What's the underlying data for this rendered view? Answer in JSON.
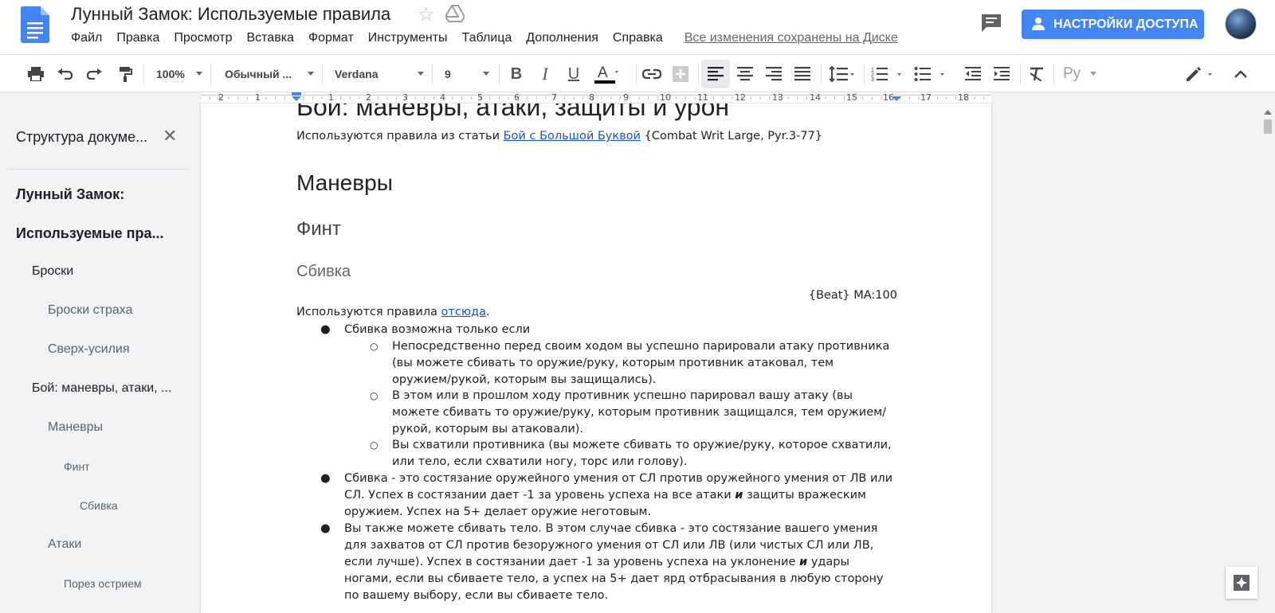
{
  "header": {
    "title": "Лунный Замок: Используемые правила",
    "menu": [
      "Файл",
      "Правка",
      "Просмотр",
      "Вставка",
      "Формат",
      "Инструменты",
      "Таблица",
      "Дополнения",
      "Справка"
    ],
    "save_status": "Все изменения сохранены на Диске",
    "share_label": "НАСТРОЙКИ ДОСТУПА"
  },
  "toolbar": {
    "zoom": "100%",
    "style": "Обычный ...",
    "font": "Verdana",
    "font_size": "9",
    "input_tools": "Ру"
  },
  "ruler": {
    "numbers": [
      "2",
      "1",
      "1",
      "2",
      "3",
      "4",
      "5",
      "6",
      "7",
      "8",
      "9",
      "10",
      "11",
      "12",
      "13",
      "14",
      "15",
      "16",
      "17",
      "18"
    ]
  },
  "outline": {
    "title": "Структура докуме...",
    "items": [
      "Лунный Замок:",
      "Используемые пра...",
      "Броски",
      "Броски страха",
      "Сверх-усилия",
      "Бой: маневры, атаки, ...",
      "Маневры",
      "Финт",
      "Сбивка",
      "Атаки",
      "Порез острием"
    ]
  },
  "document": {
    "heading1": "Бой: маневры, атаки, защиты и урон",
    "intro_prefix": "Используются правила из статьи ",
    "intro_link": "Бой с Большой Буквой",
    "intro_suffix": " {Combat Writ Large, Pyr.3-77}",
    "h_maneuvers": "Маневры",
    "h_feint": "Финт",
    "h_beat": "Сбивка",
    "beat_ref": "{Beat} MA:100",
    "rules_prefix": "Используются правила ",
    "rules_link": "отсюда",
    "rules_suffix": ".",
    "bullet1": "Сбивка возможна только если",
    "sub1": "Непосредственно перед своим ходом вы успешно парировали атаку противника (вы можете сбивать то оружие/руку, которым противник атаковал, тем оружием/рукой, которым вы защищались).",
    "sub2": "В этом или в прошлом ходу противник успешно парировал вашу атаку (вы можете сбивать то оружие/руку, которым противник защищался, тем оружием/рукой, которым вы атаковали).",
    "sub3": "Вы схватили противника (вы можете сбивать то оружие/руку, которое схватили, или тело, если схватили ногу, торс или голову).",
    "bullet2_part1": "Сбивка - это состязание оружейного умения от СЛ против оружейного умения от ЛВ или СЛ. Успех в состязании дает -1 за уровень успеха на все атаки ",
    "bullet2_em": "и",
    "bullet2_part2": " защиты вражеским оружием. Успех на 5+ делает оружие неготовым.",
    "bullet3_part1": "Вы также можете сбивать тело. В этом случае сбивка - это состязание вашего умения для захватов от СЛ против безоружного умения от СЛ или ЛВ (или чистых СЛ или ЛВ, если лучше). Успех в состязании дает -1 за уровень успеха на уклонение ",
    "bullet3_em": "и",
    "bullet3_part2": " удары ногами, если вы сбиваете тело, а успех на 5+  дает ярд отбрасывания в любую сторону по вашему выбору, если вы сбиваете тело."
  },
  "colors": {
    "accent": "#4285f4",
    "link": "#1155cc",
    "doc_icon": "#4285f4"
  }
}
